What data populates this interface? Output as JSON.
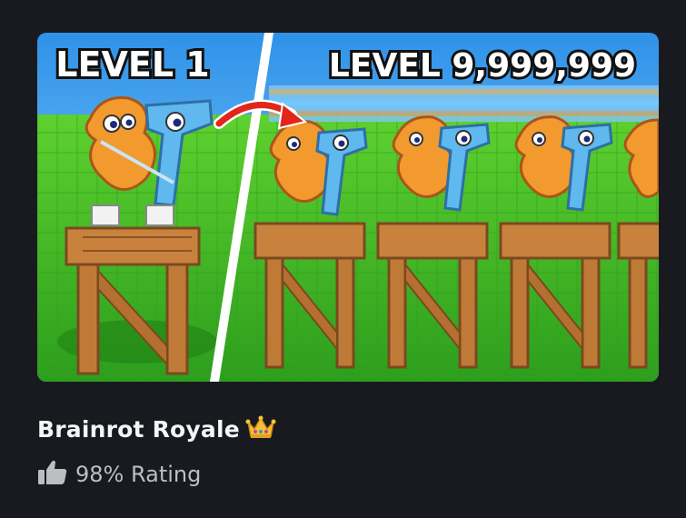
{
  "game_card": {
    "thumbnail": {
      "left_label": "LEVEL 1",
      "right_label": "LEVEL 9,999,999",
      "sky_color": "#3aa6f0",
      "grass_color": "#3fbf2a",
      "wood_color": "#c9823e",
      "arrow_color": "#e3261b"
    },
    "title": "Brainrot Royale",
    "title_badge_icon": "crown-icon",
    "rating_icon": "thumbs-up-icon",
    "rating_text": "98% Rating"
  }
}
